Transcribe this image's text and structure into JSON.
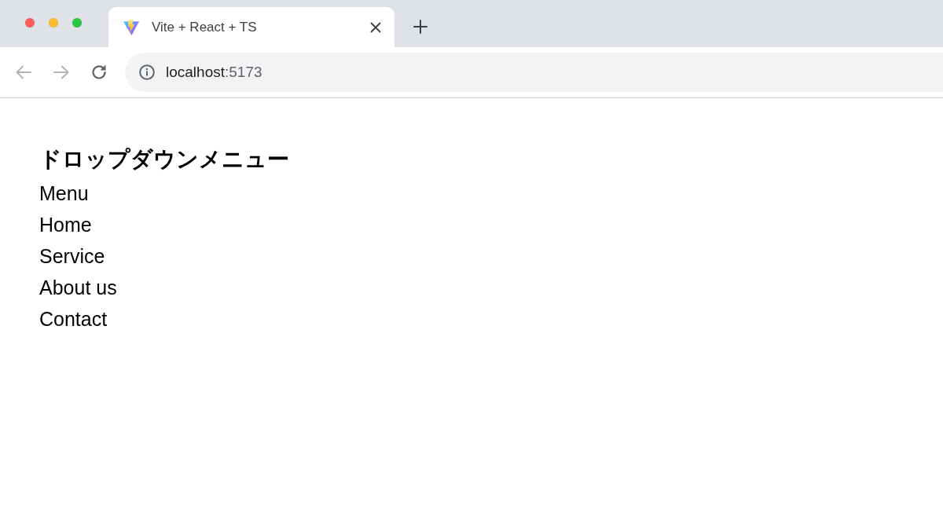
{
  "browser": {
    "tabs": [
      {
        "title": "Vite + React + TS",
        "selected": true
      }
    ],
    "navigation": [
      {
        "kind": "back",
        "disabled": true
      },
      {
        "kind": "forward",
        "disabled": true
      },
      {
        "kind": "reload",
        "disabled": false
      }
    ],
    "address": {
      "host": "localhost",
      "port": ":5173"
    }
  },
  "page": {
    "heading": "ドロップダウンメニュー",
    "menu": {
      "label": "Menu",
      "items": [
        "Home",
        "Service",
        "About us",
        "Contact"
      ]
    }
  }
}
